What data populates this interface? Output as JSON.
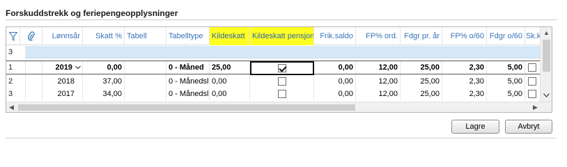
{
  "title": "Forskuddstrekk og feriepengeopplysninger",
  "columns": {
    "lonnsar": "Lønnsår",
    "skatt": "Skatt %",
    "tabell": "Tabell",
    "tabelltype": "Tabelltype",
    "kildeskatt": "Kildeskatt",
    "kildeskatt_pensjon": "Kildeskatt pensjon",
    "frik_saldo": "Frik.saldo",
    "fp_ord": "FP% ord.",
    "fdgr_pr_ar": "Fdgr pr. år",
    "fp_o60": "FP% o/60",
    "fdgr_o60": "Fdgr o/60",
    "sk_ko": "Sk.ko"
  },
  "filter_row": {
    "row_label": "3"
  },
  "rows": [
    {
      "row_label": "1",
      "lonnsar": "2019",
      "skatt": "0,00",
      "tabell": "",
      "tabelltype": "0 - Måned",
      "kildeskatt": "25,00",
      "kildeskatt_pensjon_checked": true,
      "frik_saldo": "0,00",
      "fp_ord": "12,00",
      "fdgr_pr_ar": "25,00",
      "fp_o60": "2,30",
      "fdgr_o60": "5,00"
    },
    {
      "row_label": "2",
      "lonnsar": "2018",
      "skatt": "37,00",
      "tabell": "",
      "tabelltype": "0 - Månedsl",
      "kildeskatt": "0,00",
      "kildeskatt_pensjon_checked": false,
      "frik_saldo": "0,00",
      "fp_ord": "12,00",
      "fdgr_pr_ar": "25,00",
      "fp_o60": "2,30",
      "fdgr_o60": "5,00"
    },
    {
      "row_label": "3",
      "lonnsar": "2017",
      "skatt": "34,00",
      "tabell": "",
      "tabelltype": "0 - Månedsl",
      "kildeskatt": "0,00",
      "kildeskatt_pensjon_checked": false,
      "frik_saldo": "0,00",
      "fp_ord": "12,00",
      "fdgr_pr_ar": "25,00",
      "fp_o60": "2,30",
      "fdgr_o60": "5,00"
    }
  ],
  "icons": {
    "filter": "filter-icon",
    "attachment": "paperclip-icon",
    "dropdown": "chevron-down-icon"
  },
  "colors": {
    "header_text": "#3873b8",
    "highlight": "#ffff22",
    "filter_row": "#d5e8f8"
  },
  "buttons": {
    "save": "Lagre",
    "cancel": "Avbryt"
  }
}
